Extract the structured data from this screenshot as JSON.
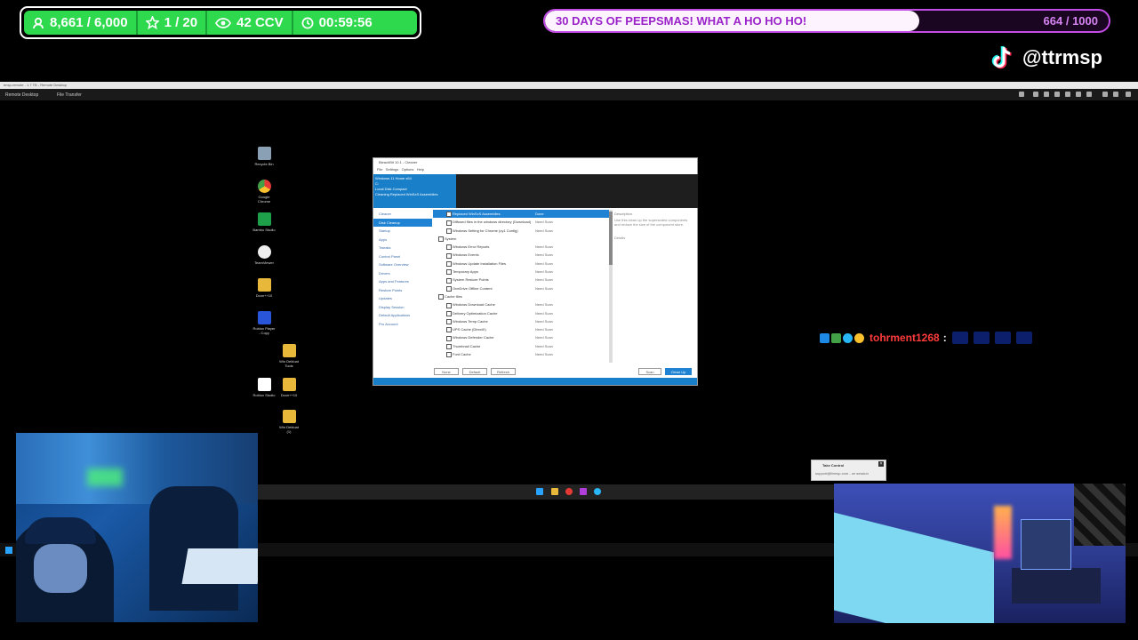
{
  "stats": {
    "followers": "8,661 / 6,000",
    "subs": "1 / 20",
    "viewers": "42 CCV",
    "timer": "00:59:56",
    "color": "#2fd94e"
  },
  "goal": {
    "text": "30 DAYS OF PEEPSMAS! WHAT A HO HO HO!",
    "count": "664 / 1000",
    "progress": 0.664,
    "color": "#c34ce6"
  },
  "tiktok": {
    "handle": "@ttrmsp",
    "icon": "tiktok-icon"
  },
  "remote": {
    "title_bar": "tmsp-remote - 1.7 TB - Remote Desktop",
    "tab_remote": "Remote Desktop",
    "tab_file": "File Transfer"
  },
  "desktop_icons": [
    "Recycle Bin",
    "Google Chrome",
    "Bambu Studio",
    "TeamViewer",
    "Dcon++10",
    "Roblox Player - Copy",
    "Win Debloat Tools",
    "Roblox Studio",
    "Dcon++10",
    "Win Debloat (1)"
  ],
  "app": {
    "title": "BleachBit 10.1 - Cleaner",
    "menu": [
      "File",
      "Settings",
      "Options",
      "Help"
    ],
    "header_lines": [
      "Windows 11 Home x64",
      "C:",
      "Local Disk Compact",
      "Cleaning Replaced WinSxS Assemblies"
    ],
    "nav": [
      "Cleaner",
      "Disk Cleanup",
      "Startup",
      "Apps",
      "Tweaks",
      "Control Panel",
      "Software Overview",
      "Drivers",
      "Apps and Features",
      "Restore Points",
      "Updates",
      "Display Session",
      "Default Applications",
      "Pro Account"
    ],
    "nav_selected": 1,
    "rows": [
      {
        "label": "Replaced WinSxS Assemblies",
        "status": "Done",
        "indent": 1,
        "sel": true
      },
      {
        "label": "Diffused files in the windows directory (Download)",
        "status": "Need Scan",
        "indent": 1
      },
      {
        "label": "Windows Setting for Chrome (cy1 Config)",
        "status": "Need Scan",
        "indent": 1
      },
      {
        "label": "System",
        "status": "",
        "indent": 0
      },
      {
        "label": "Windows Error Reports",
        "status": "Need Scan",
        "indent": 1
      },
      {
        "label": "Windows Events",
        "status": "Need Scan",
        "indent": 1
      },
      {
        "label": "Windows Update Installation Files",
        "status": "Need Scan",
        "indent": 1
      },
      {
        "label": "Temporary Apps",
        "status": "Need Scan",
        "indent": 1
      },
      {
        "label": "System Restore Points",
        "status": "Need Scan",
        "indent": 1
      },
      {
        "label": "OneDrive Offline Content",
        "status": "Need Scan",
        "indent": 1
      },
      {
        "label": "Cache files",
        "status": "",
        "indent": 0
      },
      {
        "label": "Windows Download Cache",
        "status": "Need Scan",
        "indent": 1
      },
      {
        "label": "Delivery Optimization Cache",
        "status": "Need Scan",
        "indent": 1
      },
      {
        "label": "Windows Temp Cache",
        "status": "Need Scan",
        "indent": 1
      },
      {
        "label": "UPS Cache (DirectX)",
        "status": "Need Scan",
        "indent": 1
      },
      {
        "label": "Windows Defender Cache",
        "status": "Need Scan",
        "indent": 1
      },
      {
        "label": "Thumbnail Cache",
        "status": "Need Scan",
        "indent": 1
      },
      {
        "label": "Font Cache",
        "status": "Need Scan",
        "indent": 1
      }
    ],
    "desc_title": "Description",
    "desc_text": "Use this clean up the superseded components and reduce the size of the component store.",
    "details_label": "Details",
    "btn_none": "None",
    "btn_default": "Default",
    "btn_refresh": "Refresh",
    "btn_scan": "Scan",
    "btn_cleanup": "Clean Up"
  },
  "chat": {
    "username": "tohrment1268",
    "separator": ":",
    "user_color": "#ff3b3b"
  },
  "toast": {
    "title": "Take Control",
    "body": "support@ttrmsp.com - on session"
  }
}
